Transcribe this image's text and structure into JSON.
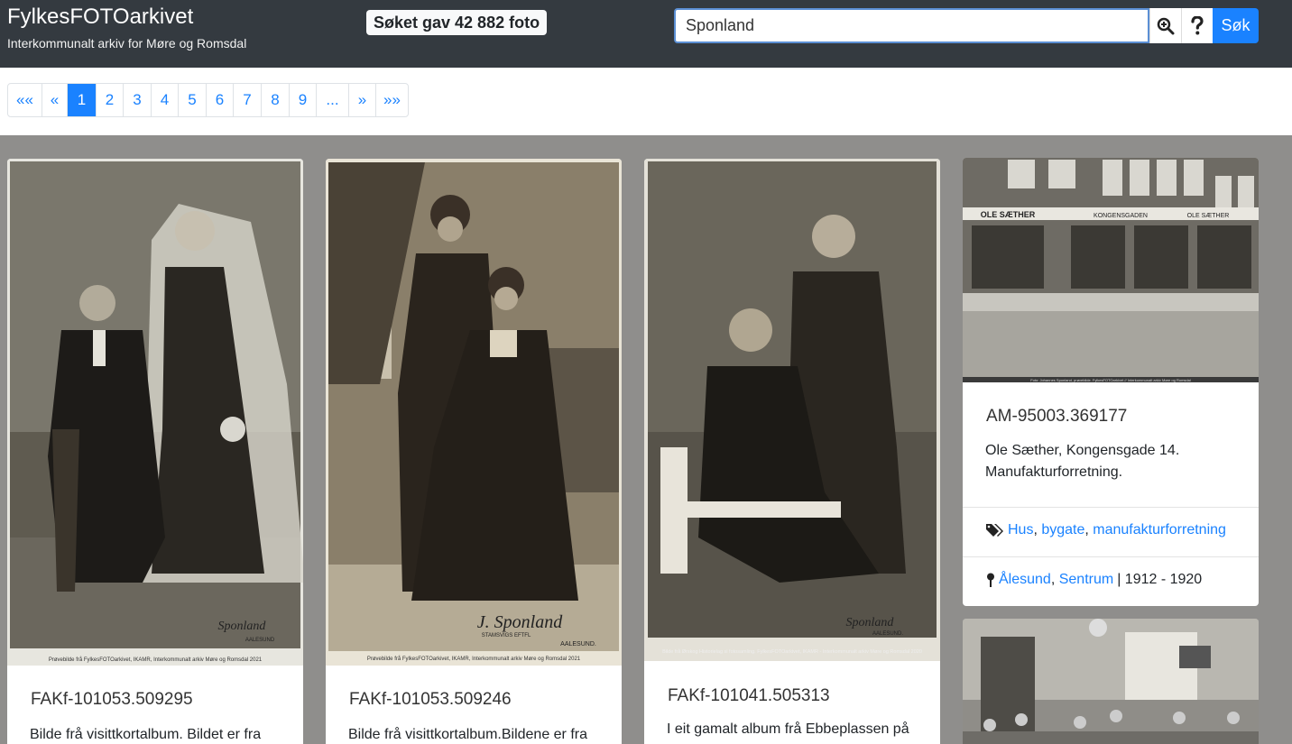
{
  "header": {
    "title": "FylkesFOTOarkivet",
    "subtitle": "Interkommunalt arkiv for Møre og Romsdal",
    "result_text": "Søket gav 42 882 foto",
    "search_value": "Sponland",
    "search_button": "Søk",
    "icons": [
      "zoom-in-icon",
      "help-question-icon"
    ]
  },
  "pagination": {
    "items": [
      "««",
      "«",
      "1",
      "2",
      "3",
      "4",
      "5",
      "6",
      "7",
      "8",
      "9",
      "...",
      "»",
      "»»"
    ],
    "active": "1"
  },
  "cards": [
    {
      "id": "FAKf-101053.509295",
      "description": "Bilde frå visittkortalbum. Bildet er fra",
      "photo_signature": "Sponland",
      "photo_place": "AALESUND",
      "photo_credit": "Prøvebilde frå FylkesFOTOarkivet, IKAMR, Interkommunalt arkiv Møre og Romsdal 2021"
    },
    {
      "id": "FAKf-101053.509246",
      "description": "Bilde frå visittkortalbum.Bildene er fra",
      "photo_signature": "J. Sponland",
      "photo_place": "AALESUND.",
      "photo_sub": "STAMSVIGS EFTFL",
      "photo_credit": "Prøvebilde frå FylkesFOTOarkivet, IKAMR, Interkommunalt arkiv Møre og Romsdal 2021"
    },
    {
      "id": "FAKf-101041.505313",
      "description": "I eit gamalt album frå Ebbeplassen på",
      "photo_signature": "Sponland",
      "photo_place": "AALESUND.",
      "photo_credit": "Bilde frå Ørskog Historielag si fotosamling. FylkesFOTOarkivet, IKAMR - Interkommunalt arkiv Møre og Romsdal 2020"
    },
    {
      "id": "AM-95003.369177",
      "description": "Ole Sæther, Kongensgade 14. Manufakturforretning.",
      "tags": [
        "Hus",
        "bygate",
        "manufakturforretning"
      ],
      "places": [
        "Ålesund",
        "Sentrum"
      ],
      "period": "| 1912 - 1920",
      "sign_1": "OLE SÆTHER",
      "sign_2": "KONGENSGADEN",
      "sign_3": "OLE SÆTHER",
      "photo_credit": "Foto: Johannes Sponland, prøvebilde. FylkesFOTOarkivet // Interkommunalt arkiv Møre og Romsdal"
    }
  ],
  "colors": {
    "header_bg": "#343a40",
    "accent": "#1a82ff",
    "gallery_bg": "#8f8e8c"
  }
}
